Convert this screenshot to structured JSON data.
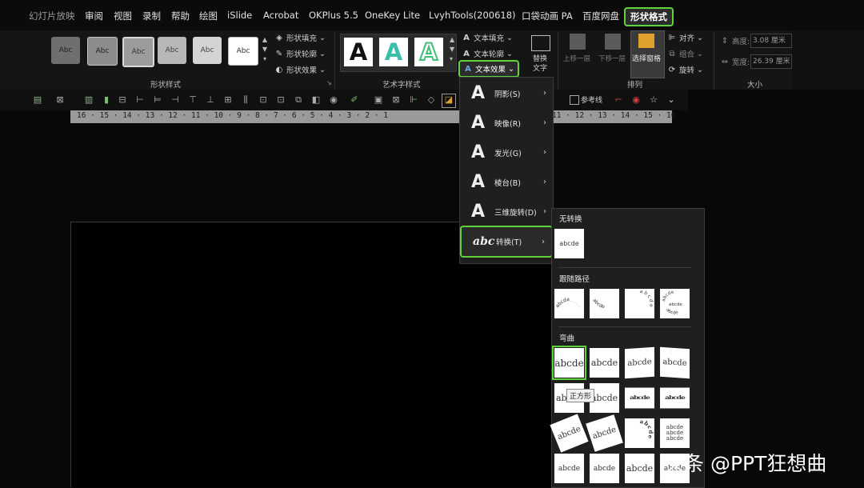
{
  "menubar": {
    "items": [
      "幻灯片放映",
      "审阅",
      "视图",
      "录制",
      "帮助",
      "绘图",
      "iSlide",
      "Acrobat",
      "OKPlus 5.5",
      "OneKey Lite",
      "LvyhTools(200618)",
      "口袋动画 PA",
      "百度网盘",
      "形状格式"
    ],
    "active": "形状格式"
  },
  "ribbon": {
    "shape_styles": {
      "thumb_label": "Abc",
      "fill": "形状填充",
      "outline": "形状轮廓",
      "effects": "形状效果",
      "label": "形状样式"
    },
    "wordart": {
      "thumb_glyph": "A",
      "text_fill": "文本填充",
      "text_outline": "文本轮廓",
      "text_effects": "文本效果",
      "label": "艺术字样式",
      "alt_text_1": "替换",
      "alt_text_2": "文字"
    },
    "arrange": {
      "bring_forward": "上移一层",
      "send_backward": "下移一层",
      "selection_pane": "选择窗格",
      "align": "对齐",
      "group": "组合",
      "rotate": "旋转",
      "label": "排列"
    },
    "size": {
      "height_label": "高度:",
      "height_value": "3.08 厘米",
      "width_label": "宽度:",
      "width_value": "26.39 厘米",
      "label": "大小"
    }
  },
  "toolbar": {
    "guides": "参考线"
  },
  "ruler": {
    "left": "16 · 15 · 14 · 13 · 12 · 11 · 10 · 9 · 8 · 7 · 6 · 5 · 4 · 3 · 2 · 1",
    "right": "11 · 12 · 13 · 14 · 15 · 16"
  },
  "text_effect_menu": {
    "items": [
      {
        "glyph": "A",
        "label": "阴影(S)"
      },
      {
        "glyph": "A",
        "label": "映像(R)"
      },
      {
        "glyph": "A",
        "label": "发光(G)"
      },
      {
        "glyph": "A",
        "label": "棱台(B)"
      },
      {
        "glyph": "A",
        "label": "三维旋转(D)"
      },
      {
        "glyph": "abc",
        "label": "转换(T)"
      }
    ],
    "selected": "转换(T)"
  },
  "transform_gallery": {
    "sections": {
      "none": "无转换",
      "follow_path": "跟随路径",
      "warp": "弯曲"
    },
    "tile_text": "abcde",
    "tooltip": "正方形"
  },
  "watermark": "头条 @PPT狂想曲",
  "colors": {
    "highlight": "#5fd43a",
    "background": "#080808",
    "menu_bg": "#1f1f1f"
  }
}
